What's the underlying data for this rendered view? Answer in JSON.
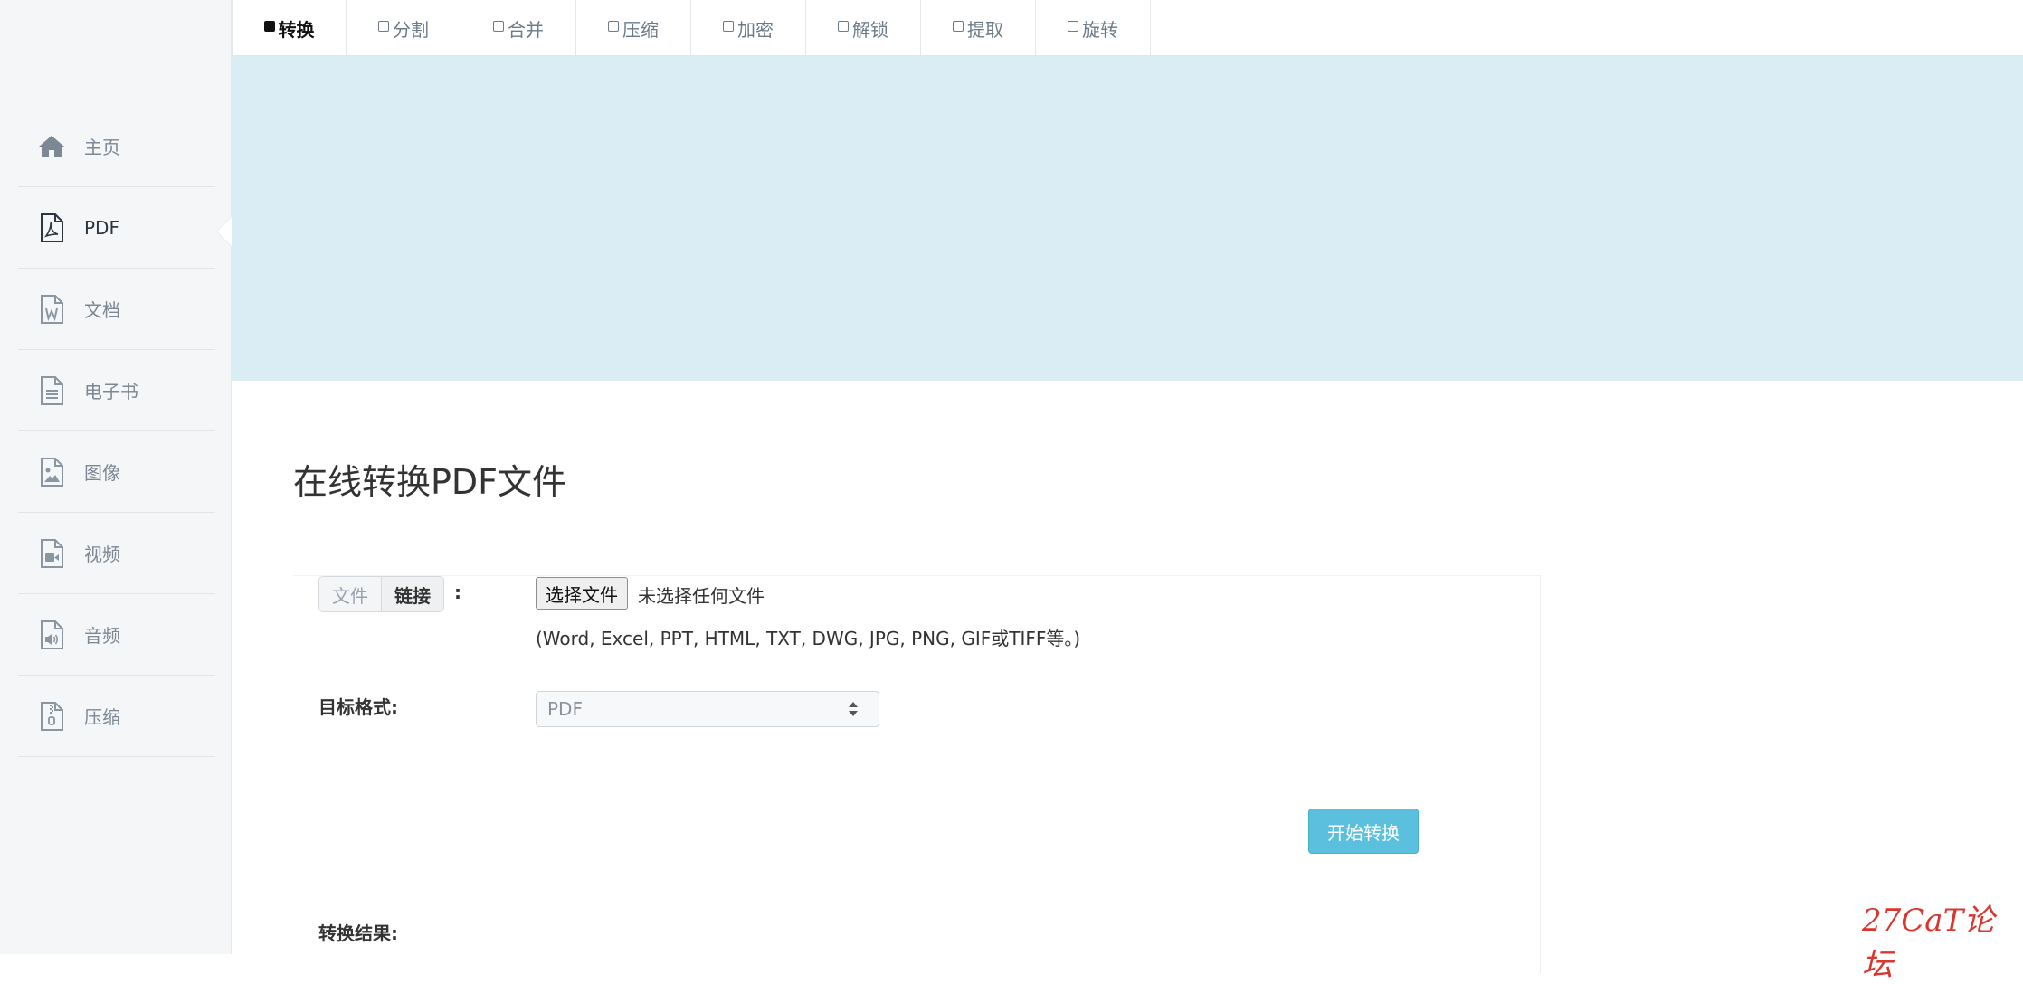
{
  "sidebar": {
    "items": [
      {
        "label": "主页",
        "icon": "home-icon"
      },
      {
        "label": "PDF",
        "icon": "pdf-file-icon"
      },
      {
        "label": "文档",
        "icon": "word-file-icon"
      },
      {
        "label": "电子书",
        "icon": "ebook-file-icon"
      },
      {
        "label": "图像",
        "icon": "image-file-icon"
      },
      {
        "label": "视频",
        "icon": "video-file-icon"
      },
      {
        "label": "音频",
        "icon": "audio-file-icon"
      },
      {
        "label": "压缩",
        "icon": "zip-file-icon"
      }
    ],
    "active_index": 1
  },
  "tabs": [
    {
      "label": "转换",
      "active": true
    },
    {
      "label": "分割"
    },
    {
      "label": "合并"
    },
    {
      "label": "压缩"
    },
    {
      "label": "加密"
    },
    {
      "label": "解锁"
    },
    {
      "label": "提取"
    },
    {
      "label": "旋转"
    }
  ],
  "main": {
    "title": "在线转换PDF文件",
    "source_toggle": {
      "file_label": "文件",
      "link_label": "链接",
      "separator": ":"
    },
    "file_input": {
      "button_label": "选择文件",
      "status": "未选择任何文件"
    },
    "hint": "(Word, Excel, PPT, HTML, TXT, DWG, JPG, PNG, GIF或TIFF等。)",
    "target_label": "目标格式:",
    "target_select": {
      "value": "PDF"
    },
    "start_button": "开始转换",
    "result_label": "转换结果:"
  },
  "watermark": "27CaT论坛",
  "colors": {
    "banner": "#daedf5",
    "sidebar_bg": "#f5f6f7",
    "primary_button": "#5bc0de",
    "watermark": "#d9362e"
  }
}
